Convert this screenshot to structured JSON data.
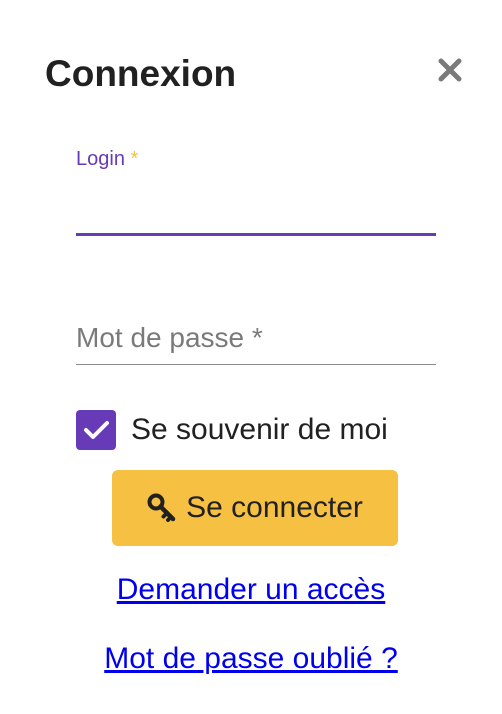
{
  "dialog": {
    "title": "Connexion",
    "close_icon": "close-icon"
  },
  "login_field": {
    "label": "Login",
    "required_marker": "*",
    "value": "",
    "accent_color": "#673ab7"
  },
  "password_field": {
    "placeholder": "Mot de passe *",
    "value": ""
  },
  "remember_me": {
    "label": "Se souvenir de moi",
    "checked": true,
    "icon": "checkmark-icon"
  },
  "submit": {
    "label": "Se connecter",
    "icon": "key-icon",
    "color": "#f6c142"
  },
  "links": {
    "request_access": "Demander un accès",
    "forgot_password": "Mot de passe oublié ?"
  }
}
